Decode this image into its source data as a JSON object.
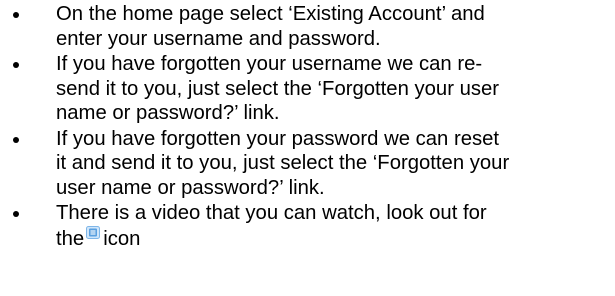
{
  "bullets": [
    {
      "lines": [
        "On the home page select ‘Existing Account’ and",
        "enter your username and password."
      ]
    },
    {
      "lines": [
        "If you have forgotten your username we can re-",
        "send it to you, just select the ‘Forgotten your user",
        "name or password?’ link."
      ]
    },
    {
      "lines": [
        "If you have forgotten your password we can reset",
        "it and send it to you, just select the ‘Forgotten your",
        "user name or password?’ link."
      ]
    },
    {
      "lines": [
        "There is a video that you can watch, look out for"
      ],
      "last_line_before_icon": "the",
      "icon": "video-icon",
      "last_line_after_icon": "icon"
    }
  ],
  "colors": {
    "text": "#000000",
    "background": "#ffffff",
    "icon_blue": "#5aa0e0",
    "icon_light": "#cfe6fb"
  }
}
